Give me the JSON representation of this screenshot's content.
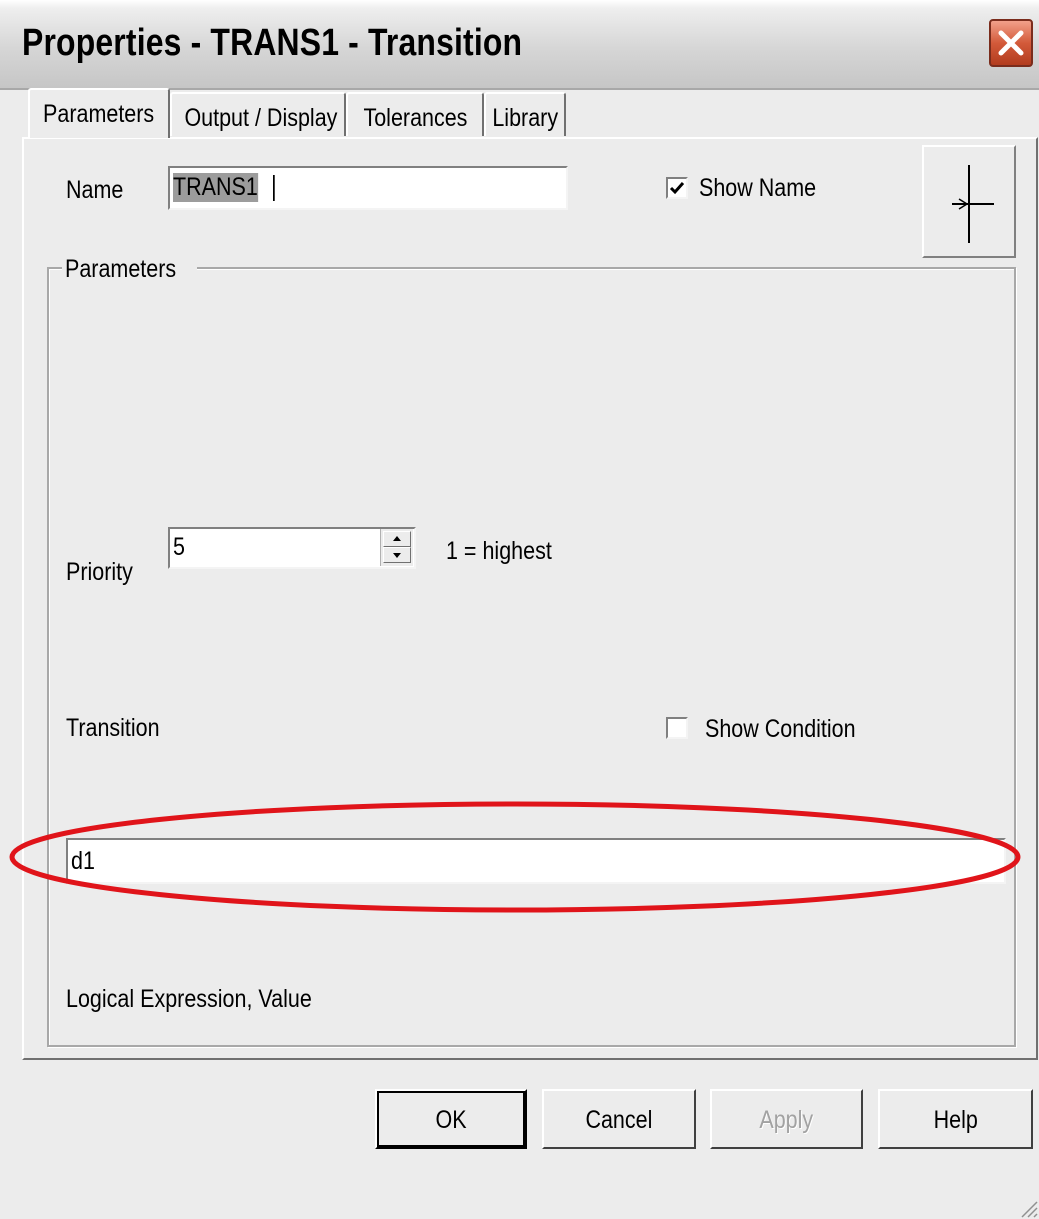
{
  "window": {
    "title": "Properties - TRANS1 - Transition",
    "close_icon": "close-icon"
  },
  "tabs": [
    {
      "label": "Parameters",
      "active": true
    },
    {
      "label": "Output / Display",
      "active": false
    },
    {
      "label": "Tolerances",
      "active": false
    },
    {
      "label": "Library",
      "active": false
    }
  ],
  "name": {
    "label": "Name",
    "value": "TRANS1"
  },
  "show_name": {
    "label": "Show Name",
    "checked": true
  },
  "symbol": {
    "icon": "transition-symbol-icon"
  },
  "parameters_group": {
    "legend": "Parameters"
  },
  "priority": {
    "label": "Priority",
    "value": "5",
    "hint": "1 = highest"
  },
  "transition": {
    "label": "Transition",
    "value": "d1",
    "caption": "Logical Expression, Value"
  },
  "show_condition": {
    "label": "Show Condition",
    "checked": false
  },
  "annotation": {
    "color": "#e0141a"
  },
  "buttons": {
    "ok": "OK",
    "cancel": "Cancel",
    "apply": "Apply",
    "help": "Help"
  }
}
